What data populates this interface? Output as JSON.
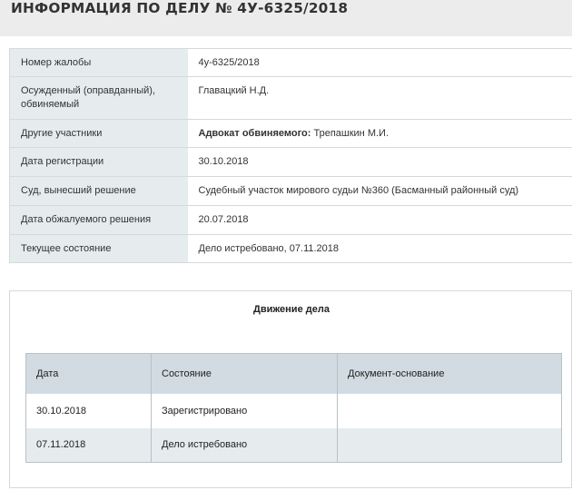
{
  "page": {
    "title": "ИНФОРМАЦИЯ ПО ДЕЛУ № 4У-6325/2018"
  },
  "case_info": {
    "rows": [
      {
        "label": "Номер жалобы",
        "value": "4у-6325/2018"
      },
      {
        "label": "Осужденный (оправданный), обвиняемый",
        "value": "Главацкий Н.Д."
      },
      {
        "label": "Другие участники",
        "value_bold": "Адвокат обвиняемого:",
        "value": " Трепашкин М.И."
      },
      {
        "label": "Дата регистрации",
        "value": "30.10.2018"
      },
      {
        "label": "Суд, вынесший решение",
        "value": "Судебный участок мирового судьи №360 (Басманный районный суд)"
      },
      {
        "label": "Дата обжалуемого решения",
        "value": "20.07.2018"
      },
      {
        "label": "Текущее состояние",
        "value": "Дело истребовано, 07.11.2018"
      }
    ]
  },
  "movement": {
    "title": "Движение дела",
    "headers": [
      "Дата",
      "Состояние",
      "Документ-основание"
    ],
    "rows": [
      {
        "date": "30.10.2018",
        "state": "Зарегистрировано",
        "document": ""
      },
      {
        "date": "07.11.2018",
        "state": "Дело истребовано",
        "document": ""
      }
    ]
  }
}
